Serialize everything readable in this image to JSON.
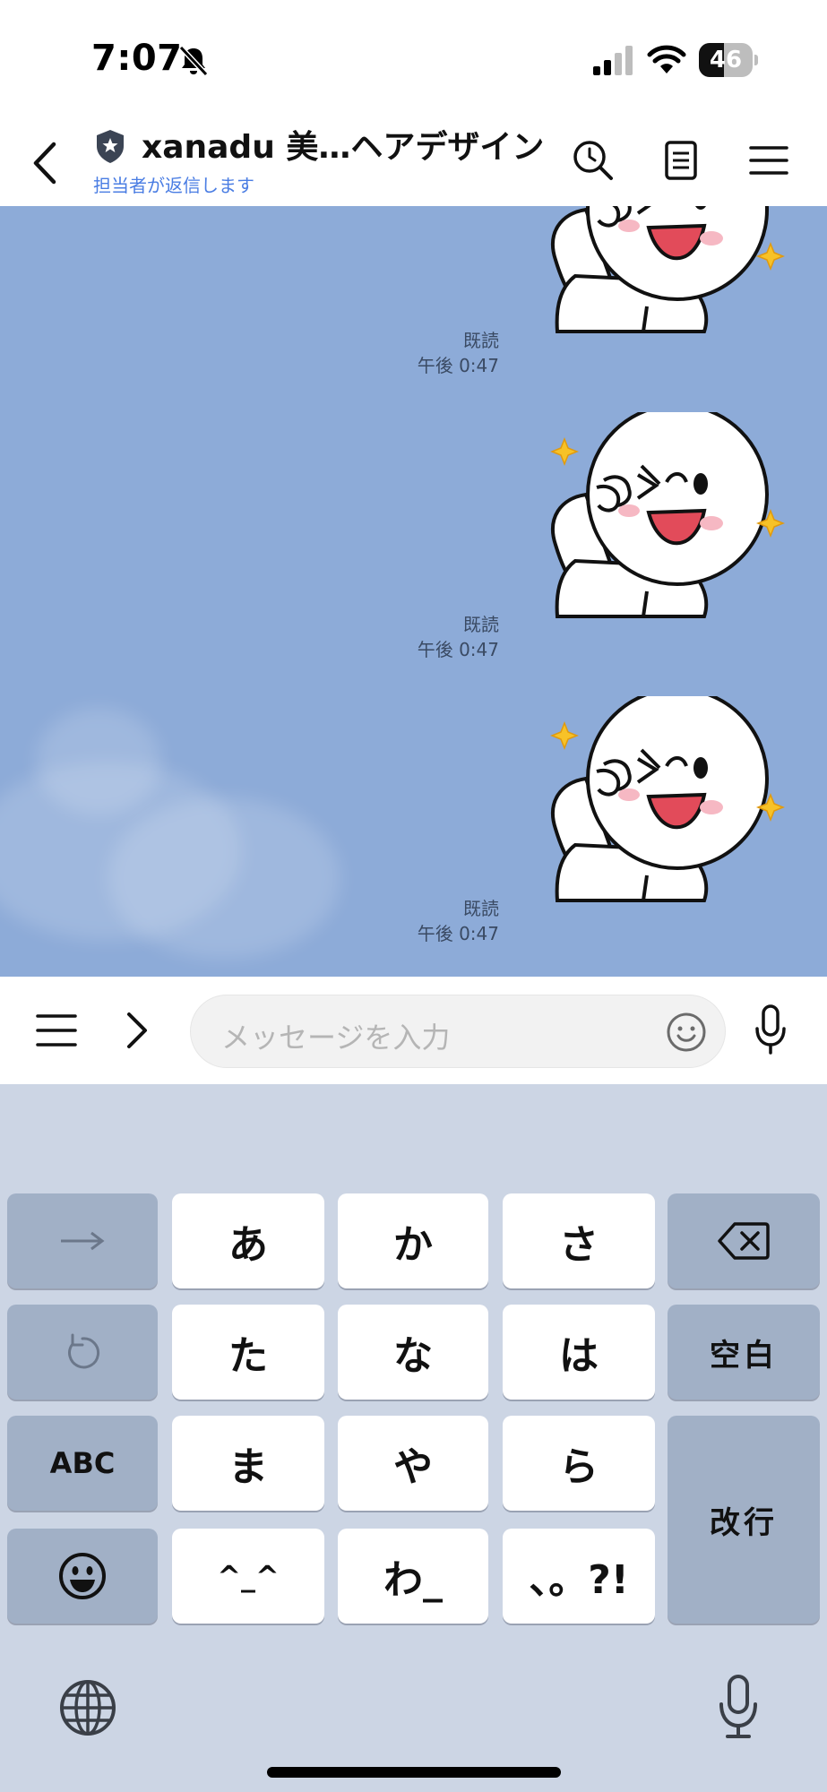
{
  "status_bar": {
    "time": "7:07",
    "battery": "46",
    "battery_level": 0.46
  },
  "header": {
    "title": "xanadu 美…ヘアデザイン",
    "subtitle": "担当者が返信します"
  },
  "messages": [
    {
      "read": "既読",
      "time": "午後 0:47",
      "sticker": "sticker-peace-sign"
    },
    {
      "read": "既読",
      "time": "午後 0:47",
      "sticker": "sticker-peace-sign"
    },
    {
      "read": "既読",
      "time": "午後 0:47",
      "sticker": "sticker-peace-sign"
    }
  ],
  "input": {
    "placeholder": "メッセージを入力"
  },
  "keyboard": {
    "keys": {
      "k_a": "あ",
      "k_ka": "か",
      "k_sa": "さ",
      "k_ta": "た",
      "k_na": "な",
      "k_ha": "は",
      "k_ma": "ま",
      "k_ya": "や",
      "k_ra": "ら",
      "k_kao": "^_^",
      "k_wa": "わ_",
      "k_punct": "、。?!",
      "abc": "ABC",
      "space": "空白",
      "enter": "改行"
    }
  },
  "colors": {
    "chat_background": "#8dabd8",
    "accent": "#4a7de3",
    "keyboard_background": "#ccd5e4"
  },
  "icons": [
    "bell-slash-icon",
    "signal-icon",
    "wifi-icon",
    "back-icon",
    "shield-star-icon",
    "search-history-icon",
    "note-icon",
    "menu-icon",
    "chevron-right-icon",
    "emoji-icon",
    "mic-icon",
    "arrow-right-icon",
    "undo-icon",
    "delete-icon",
    "globe-icon"
  ]
}
